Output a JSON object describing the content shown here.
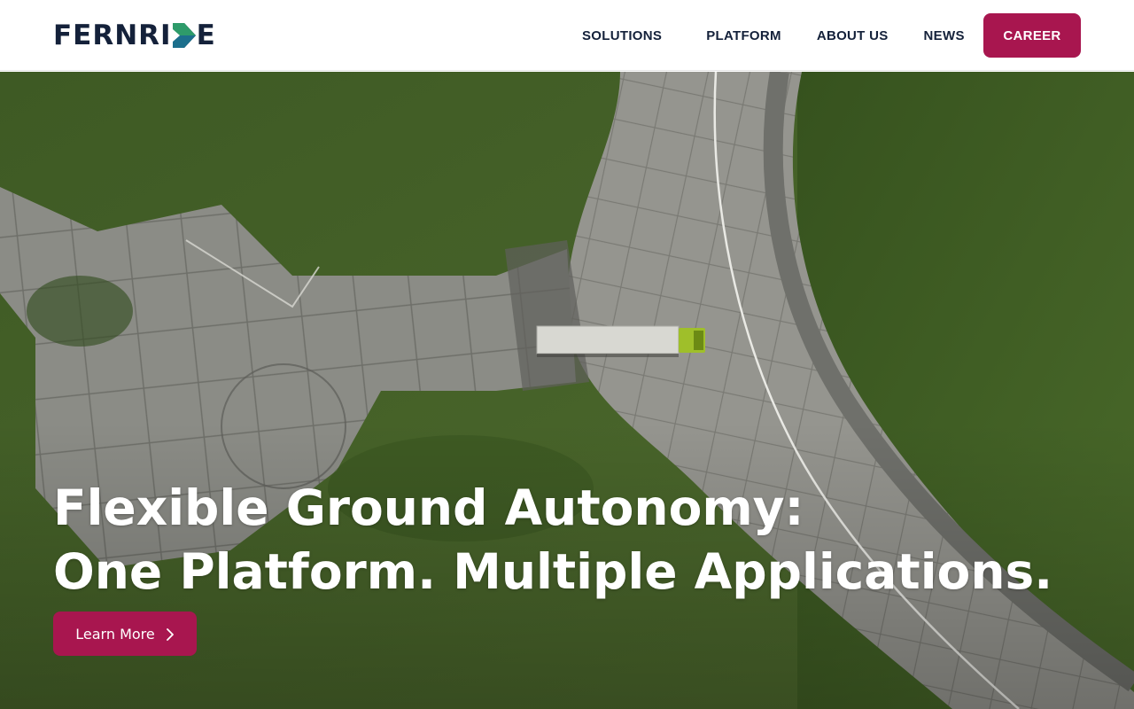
{
  "header": {
    "logo_text_left": "FERNRI",
    "logo_text_right": "E",
    "logo_icon": "fernride-d-mark-icon",
    "nav": {
      "solutions": "SOLUTIONS",
      "platform": "PLATFORM",
      "about": "ABOUT US",
      "news": "NEWS"
    },
    "career_label": "CAREER"
  },
  "hero": {
    "title_line1": "Flexible Ground Autonomy:",
    "title_line2": "One Platform. Multiple Applications.",
    "cta_label": "Learn More",
    "cta_icon": "chevron-right-icon",
    "background": "aerial-truck-on-road-image"
  },
  "colors": {
    "brand": "#a8164f",
    "logo_dark": "#14213a",
    "logo_green": "#2e9b6a"
  }
}
